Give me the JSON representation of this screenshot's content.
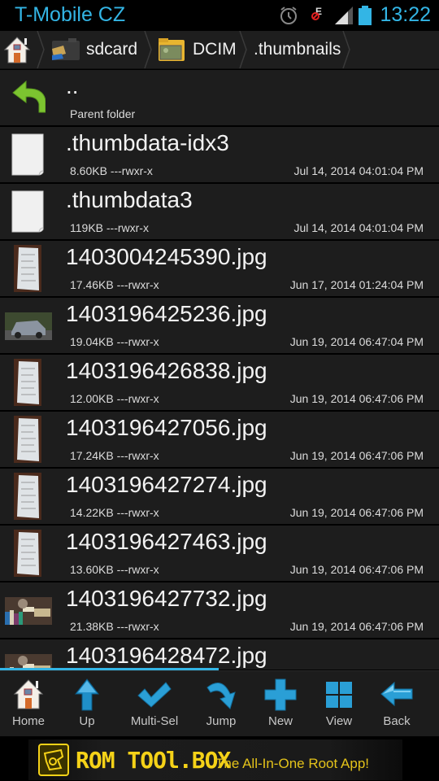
{
  "status_bar": {
    "carrier": "T-Mobile CZ",
    "time": "13:22",
    "icons": [
      "alarm-icon",
      "data-disabled-icon",
      "signal-icon",
      "battery-icon"
    ]
  },
  "breadcrumb": {
    "items": [
      {
        "label": "",
        "icon": "home-icon"
      },
      {
        "label": "sdcard",
        "icon": "sdcard-folder-icon"
      },
      {
        "label": "DCIM",
        "icon": "photo-folder-icon"
      },
      {
        "label": ".thumbnails",
        "icon": ""
      }
    ]
  },
  "files": {
    "parent": {
      "name": "..",
      "subtitle": "Parent folder"
    },
    "items": [
      {
        "name": ".thumbdata-idx3",
        "meta": "8.60KB ---rwxr-x",
        "date": "Jul 14, 2014 04:01:04 PM",
        "type": "file"
      },
      {
        "name": ".thumbdata3",
        "meta": "119KB ---rwxr-x",
        "date": "Jul 14, 2014 04:01:04 PM",
        "type": "file"
      },
      {
        "name": "1403004245390.jpg",
        "meta": "17.46KB ---rwxr-x",
        "date": "Jun 17, 2014 01:24:04 PM",
        "type": "receipt"
      },
      {
        "name": "1403196425236.jpg",
        "meta": "19.04KB ---rwxr-x",
        "date": "Jun 19, 2014 06:47:04 PM",
        "type": "car"
      },
      {
        "name": "1403196426838.jpg",
        "meta": "12.00KB ---rwxr-x",
        "date": "Jun 19, 2014 06:47:06 PM",
        "type": "receipt"
      },
      {
        "name": "1403196427056.jpg",
        "meta": "17.24KB ---rwxr-x",
        "date": "Jun 19, 2014 06:47:06 PM",
        "type": "receipt"
      },
      {
        "name": "1403196427274.jpg",
        "meta": "14.22KB ---rwxr-x",
        "date": "Jun 19, 2014 06:47:06 PM",
        "type": "receipt"
      },
      {
        "name": "1403196427463.jpg",
        "meta": "13.60KB ---rwxr-x",
        "date": "Jun 19, 2014 06:47:06 PM",
        "type": "receipt"
      },
      {
        "name": "1403196427732.jpg",
        "meta": "21.38KB ---rwxr-x",
        "date": "Jun 19, 2014 06:47:06 PM",
        "type": "books"
      },
      {
        "name": "1403196428472.jpg",
        "meta": "",
        "date": "",
        "type": "books"
      }
    ]
  },
  "toolbar": {
    "buttons": [
      {
        "label": "Home",
        "icon": "home-icon"
      },
      {
        "label": "Up",
        "icon": "up-arrow-icon"
      },
      {
        "label": "Multi-Sel",
        "icon": "checkmark-icon"
      },
      {
        "label": "Jump",
        "icon": "jump-arrow-icon"
      },
      {
        "label": "New",
        "icon": "plus-icon"
      },
      {
        "label": "View",
        "icon": "grid-view-icon"
      },
      {
        "label": "Back",
        "icon": "back-arrow-icon"
      }
    ]
  },
  "ad": {
    "title": "ROM TOOl.BOX",
    "subtitle": "The All-In-One Root App!"
  },
  "colors": {
    "accent": "#33b5e5",
    "row_bg": "#1d1d1d",
    "ad_yellow": "#f5d218"
  }
}
